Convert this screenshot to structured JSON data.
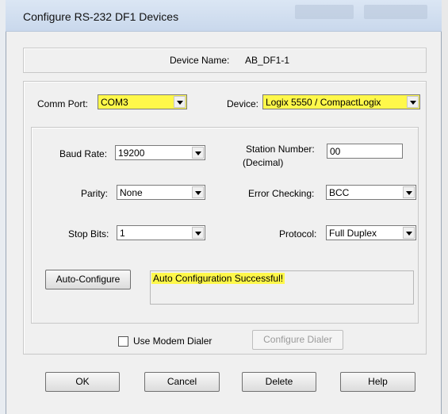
{
  "window": {
    "title": "Configure RS-232 DF1 Devices"
  },
  "device_name": {
    "label": "Device Name:",
    "value": "AB_DF1-1"
  },
  "comm": {
    "comm_port_label": "Comm Port:",
    "comm_port_value": "COM3",
    "device_label": "Device:",
    "device_value": "Logix 5550 / CompactLogix"
  },
  "settings": {
    "baud_rate_label": "Baud Rate:",
    "baud_rate_value": "19200",
    "parity_label": "Parity:",
    "parity_value": "None",
    "stop_bits_label": "Stop Bits:",
    "stop_bits_value": "1",
    "station_number_label_1": "Station Number:",
    "station_number_label_2": "(Decimal)",
    "station_number_value": "00",
    "error_checking_label": "Error Checking:",
    "error_checking_value": "BCC",
    "protocol_label": "Protocol:",
    "protocol_value": "Full Duplex"
  },
  "auto": {
    "button_label": "Auto-Configure",
    "status_text": "Auto Configuration Successful!"
  },
  "modem": {
    "checkbox_label": "Use Modem Dialer",
    "checked": false,
    "configure_dialer_label": "Configure Dialer"
  },
  "buttons": {
    "ok": "OK",
    "cancel": "Cancel",
    "delete": "Delete",
    "help": "Help"
  },
  "colors": {
    "highlight": "#fff84a"
  }
}
